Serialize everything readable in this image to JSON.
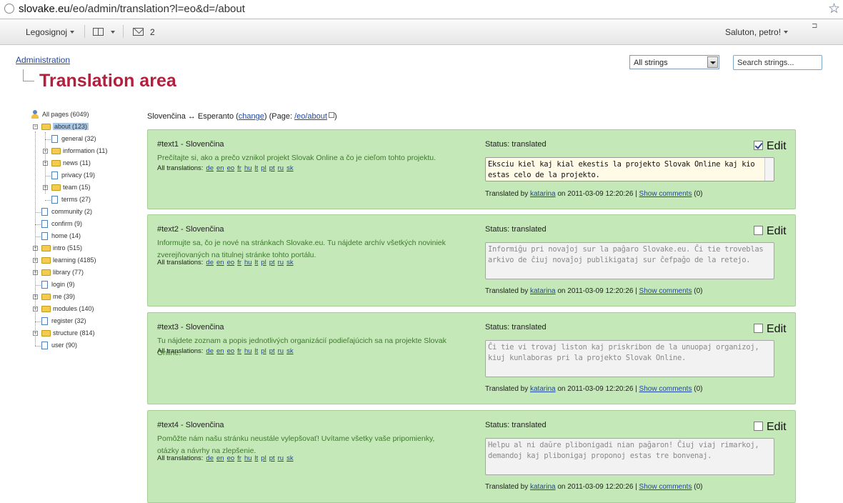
{
  "browser": {
    "url_host": "slovake.eu",
    "url_path": "/eo/admin/translation?l=eo&d=/about"
  },
  "menubar": {
    "left_menu": "Legosignoj",
    "mail_count": "2",
    "greeting": "Saluton, petro!"
  },
  "breadcrumb": "Administration",
  "page_title": "Translation area",
  "filter": {
    "selected": "All strings",
    "search_placeholder": "Search strings..."
  },
  "tree": [
    {
      "label": "All pages (6049)",
      "type": "root",
      "level": 0
    },
    {
      "label": "about (123)",
      "type": "folder",
      "level": 0,
      "expanded": true,
      "selected": true
    },
    {
      "label": "general (32)",
      "type": "doc",
      "level": 1
    },
    {
      "label": "information (11)",
      "type": "folder",
      "level": 1,
      "expandable": true
    },
    {
      "label": "news (11)",
      "type": "folder",
      "level": 1,
      "expandable": true
    },
    {
      "label": "privacy (19)",
      "type": "doc",
      "level": 1
    },
    {
      "label": "team (15)",
      "type": "folder",
      "level": 1,
      "expandable": true
    },
    {
      "label": "terms (27)",
      "type": "doc",
      "level": 1
    },
    {
      "label": "community (2)",
      "type": "doc",
      "level": 0
    },
    {
      "label": "confirm (9)",
      "type": "doc",
      "level": 0
    },
    {
      "label": "home (14)",
      "type": "doc",
      "level": 0
    },
    {
      "label": "intro (515)",
      "type": "folder",
      "level": 0,
      "expandable": true
    },
    {
      "label": "learning (4185)",
      "type": "folder",
      "level": 0,
      "expandable": true
    },
    {
      "label": "library (77)",
      "type": "folder",
      "level": 0,
      "expandable": true
    },
    {
      "label": "login (9)",
      "type": "doc",
      "level": 0
    },
    {
      "label": "me (39)",
      "type": "folder",
      "level": 0,
      "expandable": true
    },
    {
      "label": "modules (140)",
      "type": "folder",
      "level": 0,
      "expandable": true
    },
    {
      "label": "register (32)",
      "type": "doc",
      "level": 0
    },
    {
      "label": "structure (814)",
      "type": "folder",
      "level": 0,
      "expandable": true
    },
    {
      "label": "user (90)",
      "type": "doc",
      "level": 0
    }
  ],
  "lang": {
    "pair": "Slovenčina ↔ Esperanto (",
    "change": "change",
    "page_prefix": ") (Page: ",
    "page_link": "/eo/about",
    "end": ")"
  },
  "labels": {
    "all_translations": "All translations:",
    "status": "Status: translated",
    "edit": "Edit",
    "translated_by": "Translated by",
    "on": "on",
    "show_comments": "Show comments"
  },
  "languages": [
    "de",
    "en",
    "eo",
    "fr",
    "hu",
    "lt",
    "pl",
    "pt",
    "ru",
    "sk"
  ],
  "entries": [
    {
      "id": "#text1 - Slovenčina",
      "source": "Prečítajte si, ako a prečo vznikol projekt Slovak Online a čo je cieľom tohto projektu.",
      "translation": "Eksciu kiel kaj kial ekestis la projekto Slovak Online kaj kio estas celo de la projekto.",
      "checked": true,
      "active": true,
      "user": "katarina",
      "date": "2011-03-09 12:20:26",
      "comments": "(0)"
    },
    {
      "id": "#text2 - Slovenčina",
      "source": "Informujte sa, čo je nové na stránkach Slovake.eu. Tu nájdete archív všetkých noviniek zverejňovaných na titulnej stránke tohto portálu.",
      "translation": "Informiĝu pri novaĵoj sur la paĝaro Slovake.eu. Ĉi tie troveblas arkivo de ĉiuj novaĵoj publikigataj sur ĉefpaĝo de la retejo.",
      "checked": false,
      "active": false,
      "user": "katarina",
      "date": "2011-03-09 12:20:26",
      "comments": "(0)"
    },
    {
      "id": "#text3 - Slovenčina",
      "source": "Tu nájdete zoznam a popis jednotlivých organizácií podieľajúcich sa na projekte Slovak Online.",
      "translation": "Ĉi tie vi trovaj liston kaj priskribon de la unuopaj organizoj, kiuj kunlaboras pri la projekto Slovak Online.",
      "checked": false,
      "active": false,
      "user": "katarina",
      "date": "2011-03-09 12:20:26",
      "comments": "(0)"
    },
    {
      "id": "#text4 - Slovenčina",
      "source": "Pomôžte nám našu stránku neustále vylepšovať! Uvítame všetky vaše pripomienky, otázky a návrhy na zlepšenie.",
      "translation": "Helpu al ni daŭre plibonigadi nian paĝaron! Ĉiuj viaj rimarkoj, demandoj kaj plibonigaj proponoj estas tre bonvenaj.",
      "checked": false,
      "active": false,
      "user": "katarina",
      "date": "2011-03-09 12:20:26",
      "comments": "(0)"
    }
  ]
}
